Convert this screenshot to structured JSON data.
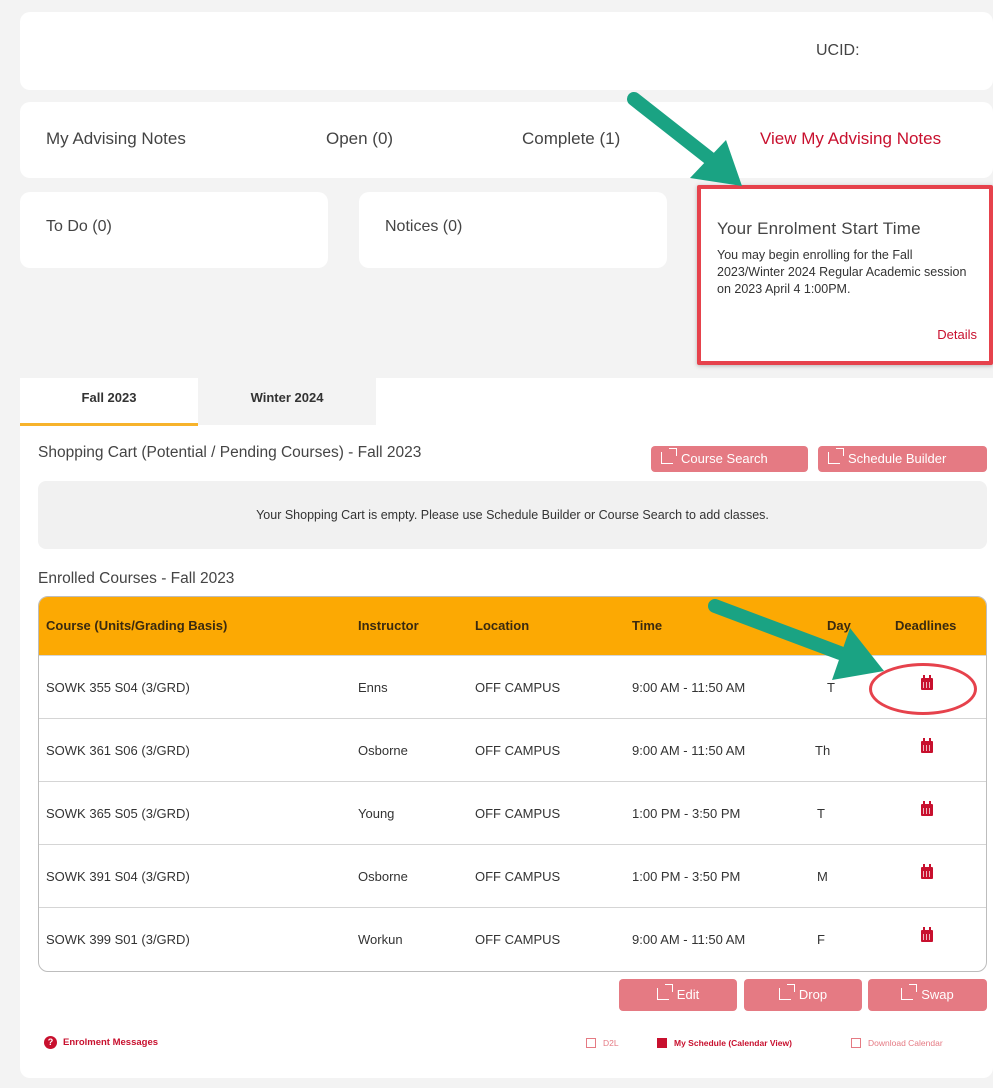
{
  "header": {
    "ucid_label": "UCID:"
  },
  "advising": {
    "title": "My Advising Notes",
    "open": "Open  (0)",
    "complete": "Complete  (1)",
    "link": "View My Advising Notes"
  },
  "todo": "To Do (0)",
  "notices": "Notices (0)",
  "enrolment": {
    "title": "Your Enrolment Start Time",
    "text": "You may begin enrolling for the Fall 2023/Winter 2024 Regular Academic session on 2023 April 4 1:00PM.",
    "details": "Details"
  },
  "tabs": {
    "fall": "Fall 2023",
    "winter": "Winter 2024"
  },
  "cart": {
    "title": "Shopping Cart (Potential / Pending Courses) - Fall 2023",
    "course_search": "Course Search",
    "schedule_builder": "Schedule Builder",
    "empty": "Your Shopping Cart is empty. Please use Schedule Builder or Course Search to add classes."
  },
  "enrolled": {
    "title": "Enrolled Courses - Fall 2023",
    "headers": [
      "Course (Units/Grading Basis)",
      "Instructor",
      "Location",
      "Time",
      "Day",
      "Deadlines"
    ],
    "rows": [
      {
        "course": "SOWK  355 S04 (3/GRD)",
        "instructor": "Enns",
        "location": "OFF CAMPUS",
        "time": "9:00 AM - 11:50 AM",
        "day": "T"
      },
      {
        "course": "SOWK  361 S06 (3/GRD)",
        "instructor": "Osborne",
        "location": "OFF CAMPUS",
        "time": "9:00 AM - 11:50 AM",
        "day": "Th"
      },
      {
        "course": "SOWK  365 S05 (3/GRD)",
        "instructor": "Young",
        "location": "OFF CAMPUS",
        "time": "1:00 PM - 3:50 PM",
        "day": "T"
      },
      {
        "course": "SOWK  391 S04 (3/GRD)",
        "instructor": "Osborne",
        "location": "OFF CAMPUS",
        "time": "1:00 PM - 3:50 PM",
        "day": "M"
      },
      {
        "course": "SOWK  399 S01 (3/GRD)",
        "instructor": "Workun",
        "location": "OFF CAMPUS",
        "time": "9:00 AM - 11:50 AM",
        "day": "F"
      }
    ]
  },
  "actions": {
    "edit": "Edit",
    "drop": "Drop",
    "swap": "Swap"
  },
  "footer": {
    "enrolment_messages": "Enrolment Messages",
    "d2l": "D2L",
    "my_schedule": "My Schedule (Calendar View)",
    "download_calendar": "Download Calendar"
  },
  "colors": {
    "accent_red": "#c8102e",
    "table_header": "#fca903",
    "button_pink": "#e57a83",
    "annotation_green": "#1aa383"
  }
}
